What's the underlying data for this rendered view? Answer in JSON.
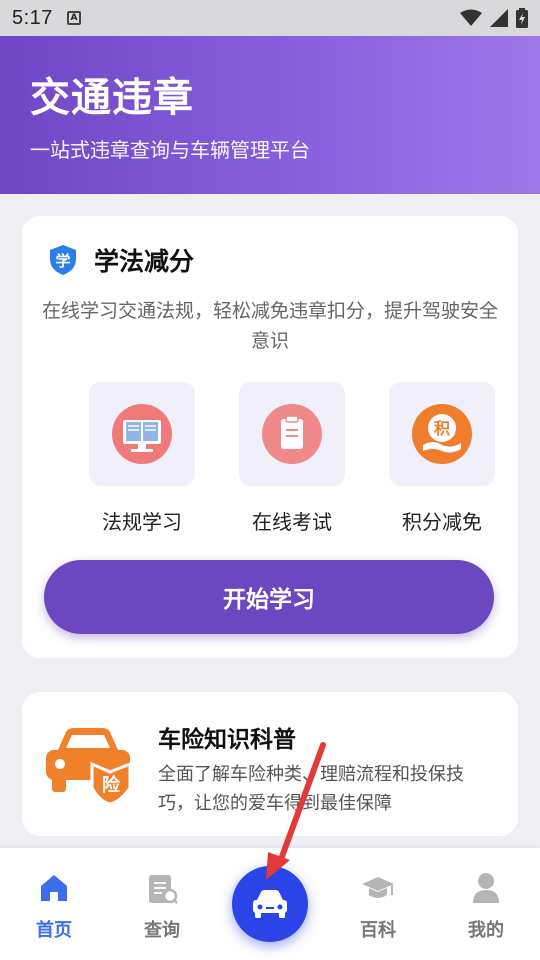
{
  "status_bar": {
    "time": "5:17",
    "notification_badge": "A"
  },
  "header": {
    "title": "交通违章",
    "subtitle": "一站式违章查询与车辆管理平台"
  },
  "study_card": {
    "badge": "学",
    "title": "学法减分",
    "description": "在线学习交通法规，轻松减免违章扣分，提升驾驶安全意识",
    "features": [
      {
        "label": "法规学习",
        "icon": "book-icon"
      },
      {
        "label": "在线考试",
        "icon": "exam-clipboard-icon"
      },
      {
        "label": "积分减免",
        "icon": "points-coin-icon",
        "icon_text": "积"
      }
    ],
    "button_label": "开始学习"
  },
  "insurance_card": {
    "title": "车险知识科普",
    "description": "全面了解车险种类、理赔流程和投保技巧，让您的爱车得到最佳保障",
    "icon_text": "险"
  },
  "tabbar": {
    "items": [
      {
        "label": "首页",
        "icon": "home-icon",
        "active": true
      },
      {
        "label": "查询",
        "icon": "search-document-icon",
        "active": false
      },
      {
        "label": "百科",
        "icon": "graduation-cap-icon",
        "active": false
      },
      {
        "label": "我的",
        "icon": "user-icon",
        "active": false
      }
    ],
    "center_icon": "car-icon"
  },
  "colors": {
    "primary": "#6c47c2",
    "active_tab": "#3b6ee8",
    "center_button": "#2a44e8",
    "insurance_orange": "#f0812a",
    "annotation_arrow": "#e23a3a"
  }
}
